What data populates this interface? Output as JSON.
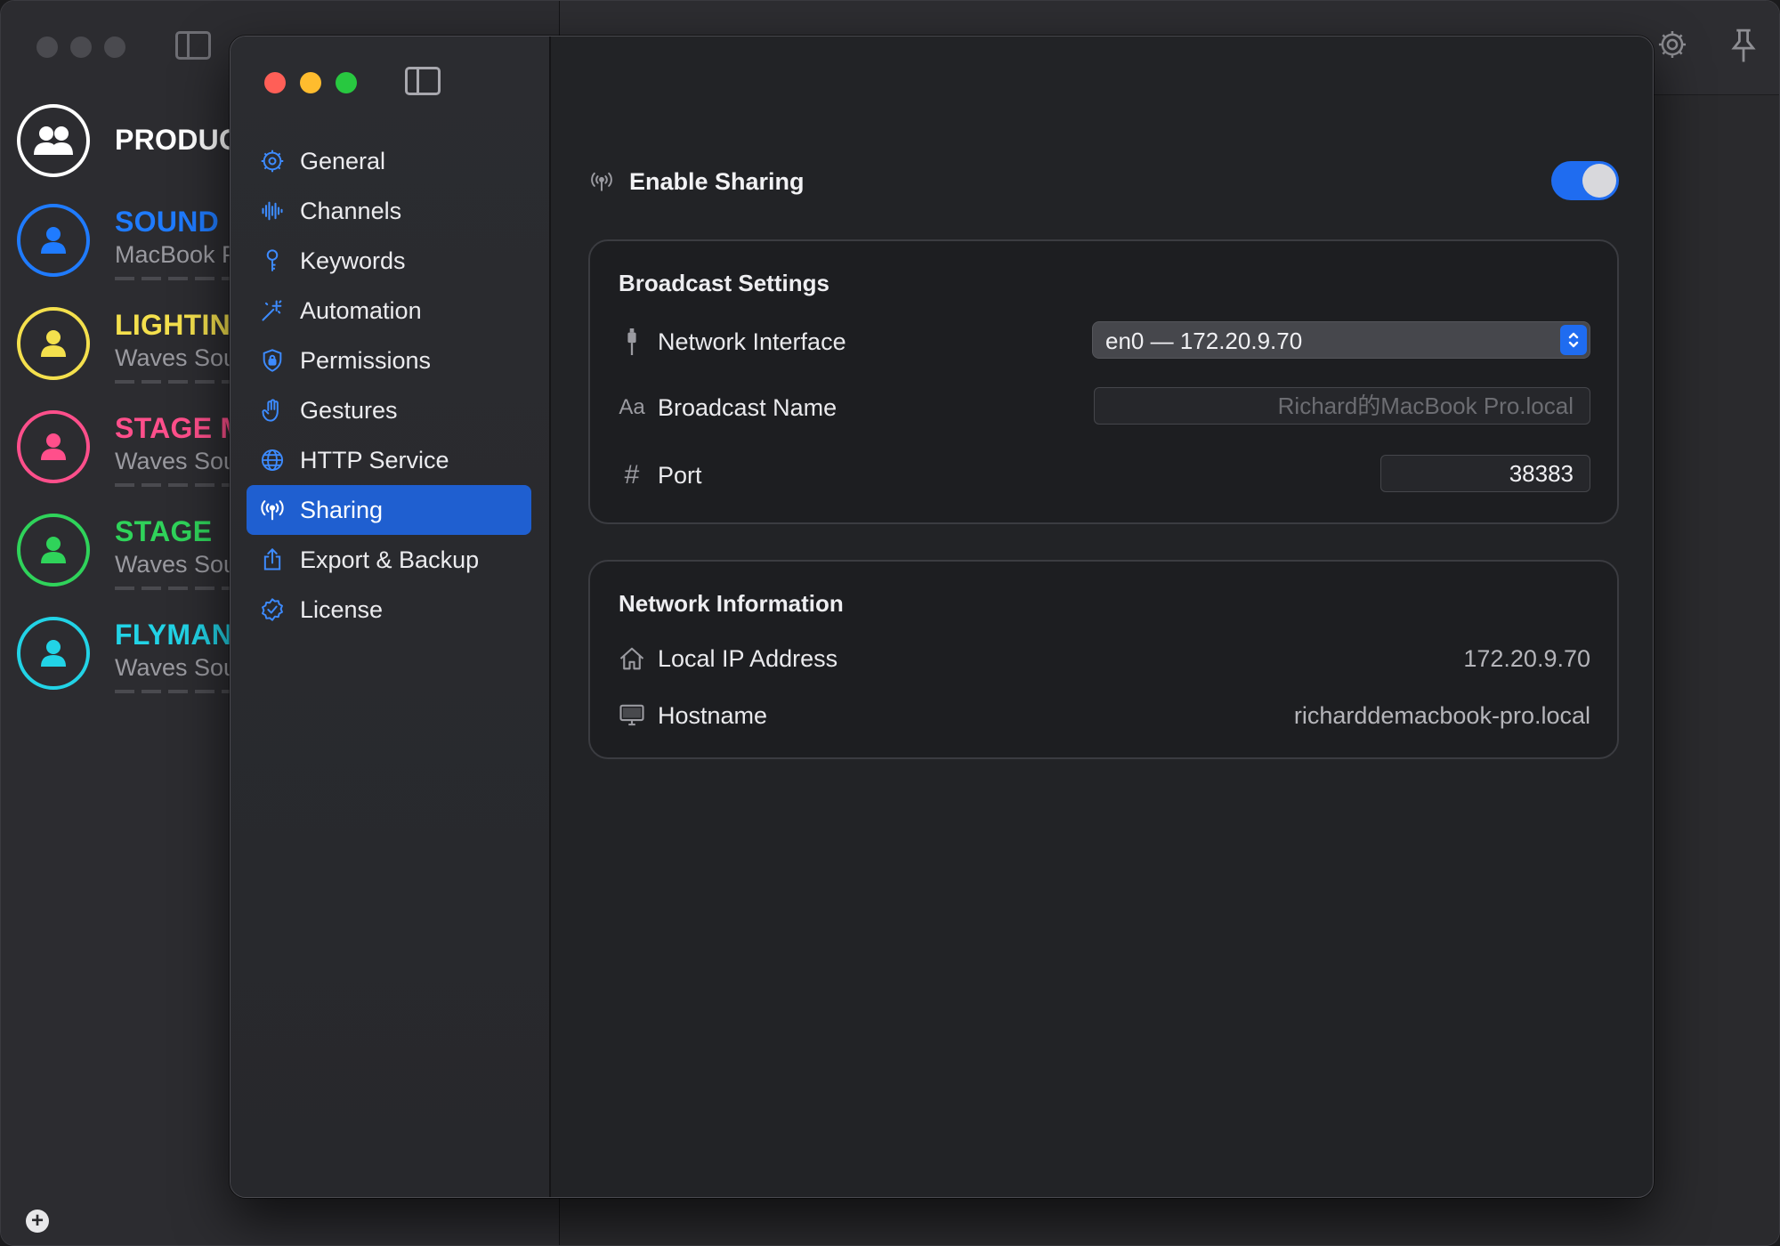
{
  "background_window": {
    "channels": [
      {
        "name": "PRODUC",
        "subtitle": "",
        "color": "#ffffff",
        "icon": "group-icon"
      },
      {
        "name": "SOUND",
        "subtitle": "MacBook P",
        "color": "#1f7bff",
        "icon": "person-icon"
      },
      {
        "name": "LIGHTIN",
        "subtitle": "Waves Sou",
        "color": "#f4e04d",
        "icon": "person-icon"
      },
      {
        "name": "STAGE M",
        "subtitle": "Waves Sou",
        "color": "#ff4f8b",
        "icon": "person-icon"
      },
      {
        "name": "STAGE",
        "subtitle": "Waves Sou",
        "color": "#2fd35a",
        "icon": "person-icon"
      },
      {
        "name": "FLYMAN",
        "subtitle": "Waves Sou",
        "color": "#22d3e6",
        "icon": "person-icon"
      }
    ],
    "toolbar_icons": [
      "gear-icon",
      "pin-icon"
    ]
  },
  "settings": {
    "sidebar": {
      "items": [
        {
          "label": "General",
          "icon": "gear-icon",
          "active": false
        },
        {
          "label": "Channels",
          "icon": "waveform-icon",
          "active": false
        },
        {
          "label": "Keywords",
          "icon": "key-icon",
          "active": false
        },
        {
          "label": "Automation",
          "icon": "wand-icon",
          "active": false
        },
        {
          "label": "Permissions",
          "icon": "lock-shield-icon",
          "active": false
        },
        {
          "label": "Gestures",
          "icon": "hand-icon",
          "active": false
        },
        {
          "label": "HTTP Service",
          "icon": "globe-icon",
          "active": false
        },
        {
          "label": "Sharing",
          "icon": "broadcast-icon",
          "active": true
        },
        {
          "label": "Export & Backup",
          "icon": "share-icon",
          "active": false
        },
        {
          "label": "License",
          "icon": "checkmark-seal-icon",
          "active": false
        }
      ]
    },
    "enable_sharing": {
      "label": "Enable Sharing",
      "enabled": true
    },
    "broadcast": {
      "title": "Broadcast Settings",
      "network_interface": {
        "label": "Network Interface",
        "value": "en0 — 172.20.9.70"
      },
      "broadcast_name": {
        "label": "Broadcast Name",
        "placeholder": "Richard的MacBook Pro.local",
        "value": ""
      },
      "port": {
        "label": "Port",
        "value": "38383"
      },
      "name_icon_text": "Aa",
      "port_icon_text": "#"
    },
    "network_info": {
      "title": "Network Information",
      "local_ip": {
        "label": "Local IP Address",
        "value": "172.20.9.70"
      },
      "hostname": {
        "label": "Hostname",
        "value": "richarddemacbook-pro.local"
      }
    },
    "accent_color": "#1f5fd0"
  }
}
